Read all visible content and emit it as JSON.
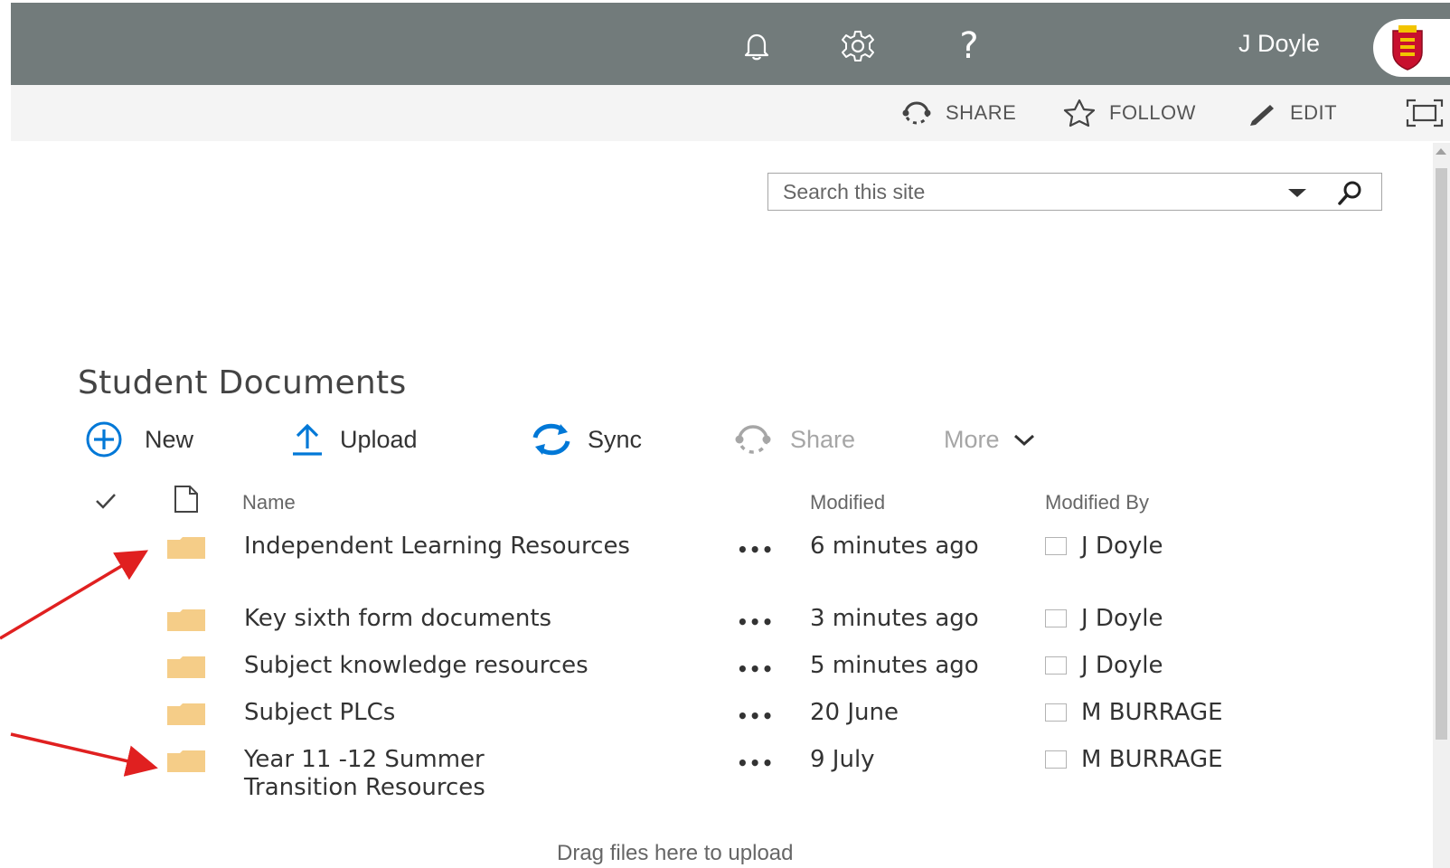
{
  "suitebar": {
    "icons": [
      "bell-icon",
      "gear-icon",
      "help-icon"
    ],
    "help_glyph": "?",
    "user_name": "J Doyle",
    "background": "#727b7b"
  },
  "actionbar": {
    "share": "SHARE",
    "follow": "FOLLOW",
    "edit": "EDIT"
  },
  "search": {
    "placeholder": "Search this site"
  },
  "library": {
    "title": "Student Documents",
    "commands": {
      "new": "New",
      "upload": "Upload",
      "sync": "Sync",
      "share": "Share",
      "more": "More"
    },
    "columns": {
      "name": "Name",
      "modified": "Modified",
      "modified_by": "Modified By"
    },
    "rows": [
      {
        "name": "Independent Learning Resources",
        "modified": "6 minutes ago",
        "modified_by": "J Doyle"
      },
      {
        "name": "Key sixth form documents",
        "modified": "3 minutes ago",
        "modified_by": "J Doyle"
      },
      {
        "name": "Subject knowledge resources",
        "modified": "5 minutes ago",
        "modified_by": "J Doyle"
      },
      {
        "name": "Subject PLCs",
        "modified": "20 June",
        "modified_by": "M BURRAGE"
      },
      {
        "name": "Year 11 -12 Summer Transition Resources",
        "modified": "9 July",
        "modified_by": "M BURRAGE"
      }
    ],
    "dots": "•••",
    "drop_hint": "Drag files here to upload"
  },
  "colors": {
    "accent": "#0078d7",
    "folder": "#f5cd88",
    "annotation_arrow": "#e02020"
  }
}
